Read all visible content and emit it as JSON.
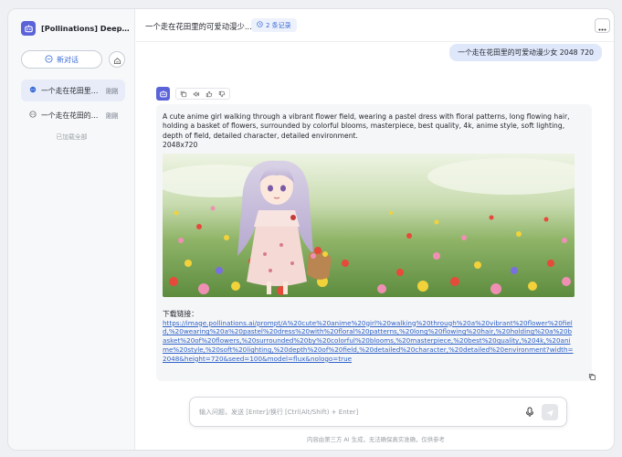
{
  "sidebar": {
    "app_title": "[Pollinations] DeepSeek...",
    "new_chat_label": "新对话",
    "conversations": [
      {
        "title": "一个走在花田里的...",
        "time": "刚刚",
        "active": true
      },
      {
        "title": "一个走在花田的可...",
        "time": "刚刚",
        "active": false
      }
    ],
    "loaded_all": "已加载全部"
  },
  "header": {
    "title": "一个走在花田里的可爱动漫少...",
    "records_badge": "2 条记录"
  },
  "messages": {
    "user": "一个走在花田里的可爱动漫少女 2048 720",
    "ai": {
      "prompt": "A cute anime girl walking through a vibrant flower field, wearing a pastel dress with floral patterns, long flowing hair, holding a basket of flowers, surrounded by colorful blooms, masterpiece, best quality, 4k, anime style, soft lighting, depth of field, detailed character, detailed environment.",
      "size": "2048x720",
      "download_label": "下载链接：",
      "download_url": "https://image.pollinations.ai/prompt/A%20cute%20anime%20girl%20walking%20through%20a%20vibrant%20flower%20field,%20wearing%20a%20pastel%20dress%20with%20floral%20patterns,%20long%20flowing%20hair,%20holding%20a%20basket%20of%20flowers,%20surrounded%20by%20colorful%20blooms,%20masterpiece,%20best%20quality,%204k,%20anime%20style,%20soft%20lighting,%20depth%20of%20field,%20detailed%20character,%20detailed%20environment?width=2048&height=720&seed=100&model=flux&nologo=true"
    }
  },
  "input": {
    "placeholder": "输入问题，发送 [Enter]/换行 [Ctrl(Alt/Shift) + Enter]",
    "value": ""
  },
  "footer": {
    "disclaimer": "内容由第三方 AI 生成，无法确保真实准确，仅供参考"
  },
  "icons": {
    "app_logo": "bot-icon",
    "new_chat": "chat-plus-icon",
    "home": "home-icon",
    "records": "clock-icon",
    "more": "more-dots-icon",
    "copy": "copy-icon",
    "speak": "speaker-icon",
    "like": "thumbs-up-icon",
    "dislike": "thumbs-down-icon",
    "mic": "mic-icon",
    "send": "send-icon"
  },
  "colors": {
    "accent": "#3c6bd6",
    "bot_avatar": "#5b63d8",
    "user_bubble": "#dfe8fb"
  }
}
